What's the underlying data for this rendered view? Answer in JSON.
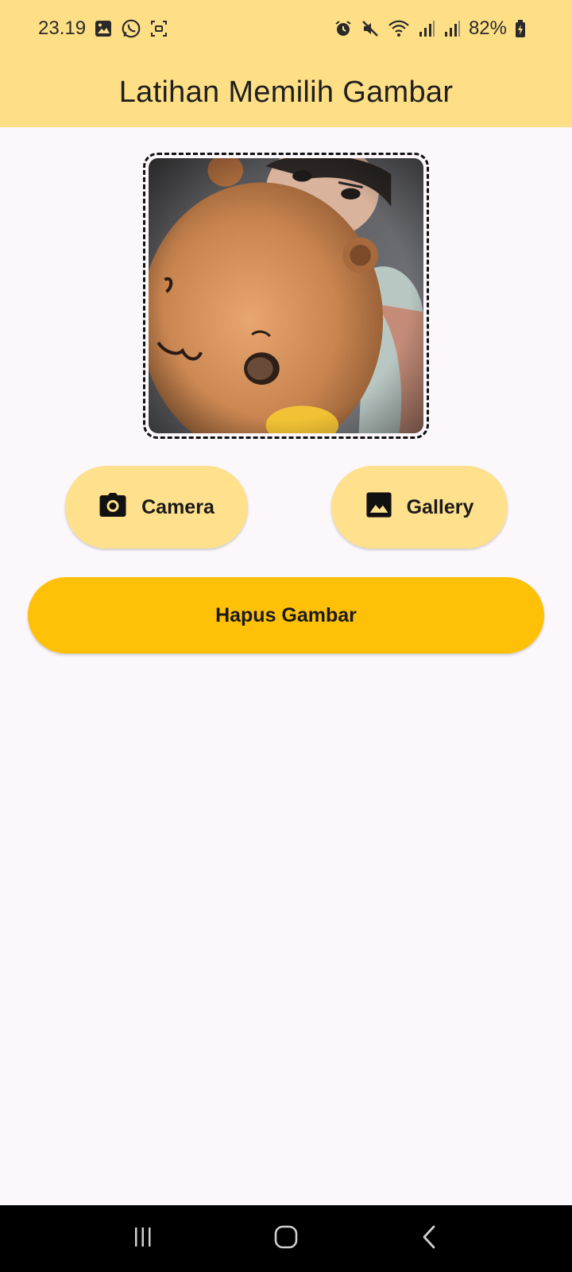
{
  "status_bar": {
    "time": "23.19",
    "battery": "82%",
    "left_icons": [
      "image-icon",
      "whatsapp-icon",
      "screen-record-icon"
    ],
    "right_icons": [
      "alarm-icon",
      "mute-icon",
      "wifi-icon",
      "signal-icon",
      "signal-icon",
      "battery-icon"
    ]
  },
  "app_bar": {
    "title": "Latihan Memilih Gambar",
    "background": "#FFDF85"
  },
  "image_preview": {
    "icon": "photo"
  },
  "buttons": {
    "camera_label": "Camera",
    "camera_icon": "camera-icon",
    "gallery_label": "Gallery",
    "gallery_icon": "gallery-icon",
    "delete_label": "Hapus Gambar",
    "accent_light": "#FFE08C",
    "accent_strong": "#FFC107"
  },
  "nav_bar": {
    "items": [
      "recent-apps-icon",
      "home-icon",
      "back-icon"
    ]
  }
}
